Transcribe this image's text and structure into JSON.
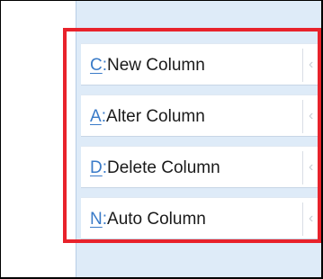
{
  "menu": {
    "items": [
      {
        "hotkey": "C",
        "separator": ":",
        "label": "New Column",
        "arrow": "‹"
      },
      {
        "hotkey": "A",
        "separator": ":",
        "label": "Alter Column",
        "arrow": "‹"
      },
      {
        "hotkey": "D",
        "separator": ":",
        "label": "Delete Column",
        "arrow": "‹"
      },
      {
        "hotkey": "N",
        "separator": ":",
        "label": "Auto Column",
        "arrow": "‹"
      }
    ]
  },
  "colors": {
    "panel_background": "#deebf8",
    "hotkey": "#3a7bc8",
    "highlight_border": "#e8222b"
  }
}
